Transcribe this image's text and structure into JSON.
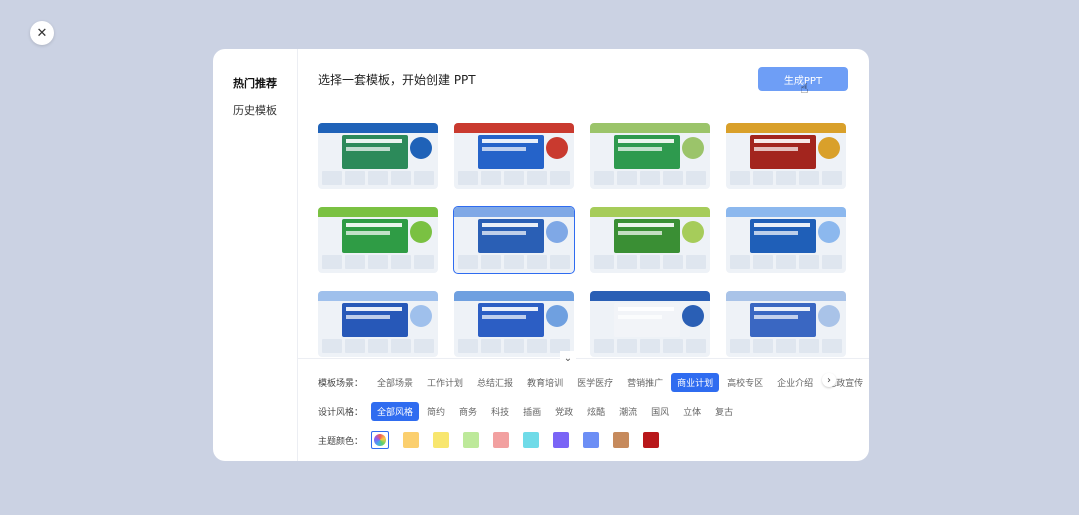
{
  "close_icon": "✕",
  "sidebar": {
    "items": [
      {
        "label": "热门推荐",
        "active": true
      },
      {
        "label": "历史模板",
        "active": false
      }
    ]
  },
  "main": {
    "title": "选择一套模板，开始创建 PPT",
    "generate_button": "生成PPT"
  },
  "templates": [
    {
      "title": "企业智能工厂产品推广计划",
      "color": "#2c8a5a",
      "accent": "#1f62b8"
    },
    {
      "title": "行业竞争财务分析计划",
      "color": "#2563c9",
      "accent": "#c93a2f"
    },
    {
      "title": "农业农村发展调查报告",
      "color": "#2e9a4e",
      "accent": "#9bc46a"
    },
    {
      "title": "IT新时代信息化建设计划",
      "color": "#a3251e",
      "accent": "#d9a02a"
    },
    {
      "title": "生态农业效率提升计划",
      "color": "#2f9c45",
      "accent": "#7ac142"
    },
    {
      "title": "企业营销管理计划",
      "color": "#2a5fb5",
      "accent": "#7fa8e6"
    },
    {
      "title": "农业市场营销管理计划",
      "color": "#3a8f34",
      "accent": "#a6cc5a"
    },
    {
      "title": "云端数据分析与管理计划",
      "color": "#1f5fb8",
      "accent": "#8cb8ee"
    },
    {
      "title": "信息化管理与实施方案",
      "color": "#2758b8",
      "accent": "#9fc0ec"
    },
    {
      "title": "数字化转型战略规划",
      "color": "#2c5ec4",
      "accent": "#6fa0e0"
    },
    {
      "title": "市场营销分析策划计划",
      "color": "#f2f4f8",
      "accent": "#2a5fb5"
    },
    {
      "title": "数字化转型方案与实施计划",
      "color": "#3a67c2",
      "accent": "#a9c3e8"
    }
  ],
  "filters": {
    "scene_label": "模板场景：",
    "scenes": [
      {
        "label": "全部场景",
        "active": false
      },
      {
        "label": "工作计划",
        "active": false
      },
      {
        "label": "总结汇报",
        "active": false
      },
      {
        "label": "教育培训",
        "active": false
      },
      {
        "label": "医学医疗",
        "active": false
      },
      {
        "label": "营销推广",
        "active": false
      },
      {
        "label": "商业计划",
        "active": true
      },
      {
        "label": "高校专区",
        "active": false
      },
      {
        "label": "企业介绍",
        "active": false
      },
      {
        "label": "党政宣传",
        "active": false
      }
    ],
    "style_label": "设计风格：",
    "styles": [
      {
        "label": "全部风格",
        "active": true
      },
      {
        "label": "简约",
        "active": false
      },
      {
        "label": "商务",
        "active": false
      },
      {
        "label": "科技",
        "active": false
      },
      {
        "label": "插画",
        "active": false
      },
      {
        "label": "党政",
        "active": false
      },
      {
        "label": "炫酷",
        "active": false
      },
      {
        "label": "潮流",
        "active": false
      },
      {
        "label": "国风",
        "active": false
      },
      {
        "label": "立体",
        "active": false
      },
      {
        "label": "复古",
        "active": false
      }
    ],
    "color_label": "主题颜色：",
    "colors": [
      "all",
      "#fbcf6e",
      "#f8e66e",
      "#bde99a",
      "#f2a0a0",
      "#6fdbe8",
      "#7a64f6",
      "#6c8ef5",
      "#c68a5c",
      "#b8171a"
    ]
  }
}
